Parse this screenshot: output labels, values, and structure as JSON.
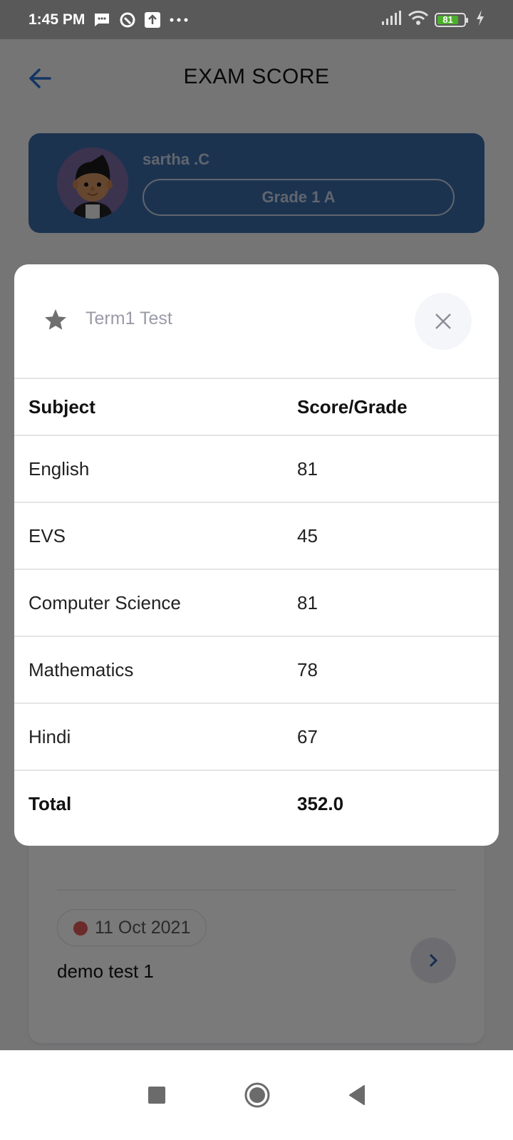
{
  "status_bar": {
    "time": "1:45 PM",
    "left_icons": [
      "message-icon",
      "sync-icon",
      "upload-icon",
      "more-dots-icon"
    ],
    "battery_level": "81",
    "right_icons": [
      "signal-icon",
      "wifi-icon",
      "battery-icon",
      "charging-icon"
    ]
  },
  "app_bar": {
    "back_icon": "arrow-left-icon",
    "title": "EXAM SCORE"
  },
  "profile": {
    "name": "sartha .C",
    "grade": "Grade 1 A"
  },
  "exam_list": [
    {
      "date": "",
      "title": "Term1 Test"
    },
    {
      "date": "11 Oct 2021",
      "title": "demo test 1"
    }
  ],
  "dialog": {
    "title": "Term1 Test",
    "icon": "star-icon",
    "close_icon": "close-icon",
    "table": {
      "headers": [
        "Subject",
        "Score/Grade"
      ],
      "rows": [
        {
          "subject": "English",
          "score": "81"
        },
        {
          "subject": "EVS",
          "score": "45"
        },
        {
          "subject": "Computer Science",
          "score": "81"
        },
        {
          "subject": "Mathematics",
          "score": "78"
        },
        {
          "subject": "Hindi",
          "score": "67"
        }
      ],
      "total_label": "Total",
      "total_value": "352.0"
    }
  },
  "nav_bar": {
    "buttons": [
      "recents-icon",
      "home-icon",
      "back-icon"
    ]
  },
  "colors": {
    "primary": "#3b6ba7",
    "status_dot": "#e25b5b"
  }
}
